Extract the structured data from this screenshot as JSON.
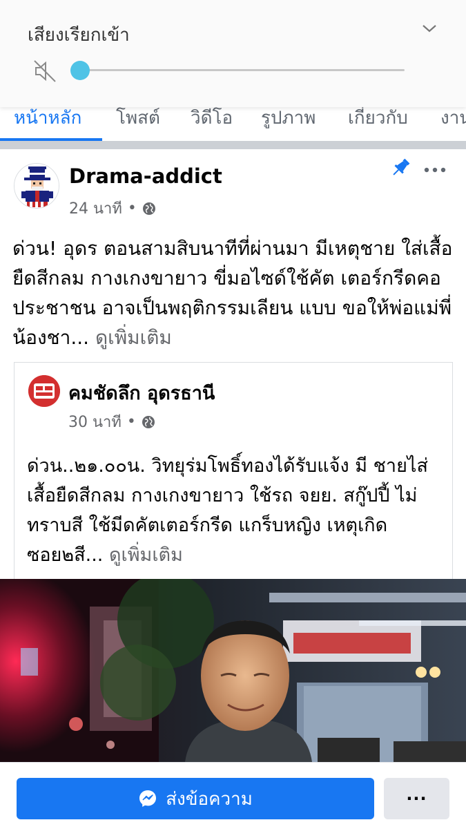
{
  "volume_panel": {
    "title": "เสียงเรียกเข้า",
    "level": 0.0,
    "accent_color": "#4fc3e6",
    "muted": true,
    "icons": [
      "speaker-muted-icon",
      "chevron-down-icon"
    ]
  },
  "tabs": [
    {
      "label": "หน้าหลัก",
      "active": true
    },
    {
      "label": "โพสต์",
      "active": false
    },
    {
      "label": "วิดีโอ",
      "active": false
    },
    {
      "label": "รูปภาพ",
      "active": false
    },
    {
      "label": "เกี่ยวกับ",
      "active": false
    },
    {
      "label": "งาน",
      "active": false
    }
  ],
  "post": {
    "author": "Drama-addict",
    "time": "24 นาที",
    "audience_separator": "•",
    "text": "ด่วน! อุดร ตอนสามสิบนาทีที่ผ่านมา มีเหตุชาย ใส่เสื้อยืดสีกลม กางเกงขายาว ขี่มอไซด์ใช้คัต เตอร์กรีดคอประชาชน อาจเป็นพฤติกรรมเลียน แบบ ขอให้พ่อแม่พี่น้องชา... ",
    "see_more": "ดูเพิ่มเติม",
    "icons": [
      "pin-icon",
      "more-horizontal-icon",
      "globe-icon"
    ]
  },
  "shared_post": {
    "author": "คมชัดลึก อุดรธานี",
    "avatar_text": "คม ชัด ลึก",
    "time": "30 นาที",
    "audience_separator": "•",
    "text": "ด่วน..๒๑.๐๐น. วิทยุร่มโพธิ์ทองได้รับแจ้ง มี ชายไส่เสื้อยืดสีกลม กางเกงขายาว  ใช้รถ จยย. สกู๊ปปี้ ไม่ทราบสี  ใช้มีดคัตเตอร์กรีด แกร็บหญิง เหตุเกิดซอย๒สี... ",
    "see_more": "ดูเพิ่มเติม"
  },
  "bottom_bar": {
    "message_label": "ส่งข้อความ",
    "more_label": "···",
    "accent_color": "#1877f2"
  }
}
